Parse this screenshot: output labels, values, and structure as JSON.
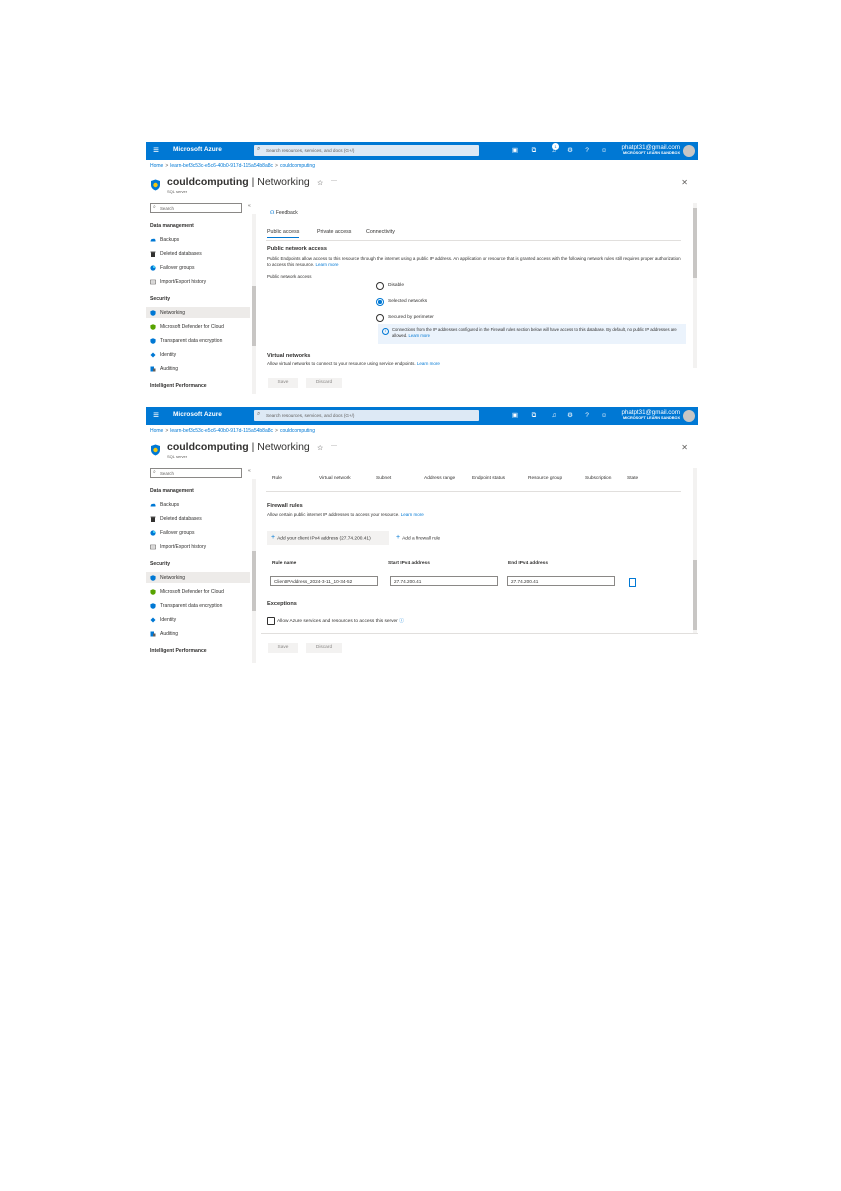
{
  "portal": {
    "brand": "Microsoft Azure",
    "search_placeholder": "Search resources, services, and docs (G+/)",
    "notification_count": "1",
    "account_email": "phatpt31@gmail.com",
    "account_directory": "MICROSOFT LEARN SANDBOX"
  },
  "breadcrumb": {
    "home": "Home",
    "resource_group": "learn-bef3c53c-e5c6-40b0-917d-115a54b8a8c",
    "server": "couldcomputing"
  },
  "page": {
    "title_bold": "couldcomputing",
    "title_rest": " | Networking",
    "subtitle": "SQL server"
  },
  "sidebar": {
    "search_placeholder": "Search",
    "collapse_glyph": "«",
    "groups": [
      {
        "label": "Data management",
        "items": [
          "Backups",
          "Deleted databases",
          "Failover groups",
          "Import/Export history"
        ]
      },
      {
        "label": "Security",
        "items": [
          "Networking",
          "Microsoft Defender for Cloud",
          "Transparent data encryption",
          "Identity",
          "Auditing"
        ]
      },
      {
        "label": "Intelligent Performance",
        "items": []
      }
    ],
    "selected": "Networking"
  },
  "colors": {
    "accent": "#0078d4",
    "selected_bg": "#edebe9",
    "info_bg": "#ebf3fc"
  },
  "screen1": {
    "feedback": "Feedback",
    "tabs": [
      "Public access",
      "Private access",
      "Connectivity"
    ],
    "active_tab": "Public access",
    "section_title": "Public network access",
    "description": "Public Endpoints allow access to this resource through the internet using a public IP address. An application or resource that is granted access with the following network rules still requires proper authorization to access this resource.",
    "learn_more": "Learn more",
    "field_label": "Public network access",
    "options": [
      "Disable",
      "Selected networks",
      "Secured by perimeter"
    ],
    "selected_option": "Selected networks",
    "info_text": "Connections from the IP addresses configured in the Firewall rules section below will have access to this database. By default, no public IP addresses are allowed.",
    "info_link": "Learn more",
    "vnet_title": "Virtual networks",
    "vnet_desc": "Allow virtual networks to connect to your resource using service endpoints.",
    "vnet_link": "Learn more",
    "save": "Save",
    "discard": "Discard"
  },
  "screen2": {
    "vnet_columns": [
      "Rule",
      "Virtual network",
      "Subnet",
      "Address range",
      "Endpoint status",
      "Resource group",
      "Subscription",
      "State"
    ],
    "firewall_title": "Firewall rules",
    "firewall_desc": "Allow certain public internet IP addresses to access your resource.",
    "firewall_link": "Learn more",
    "add_client_ip": "Add your client IPv4 address (27.74.200.41)",
    "add_rule": "Add a firewall rule",
    "columns": {
      "rule_name": "Rule name",
      "start_ip": "Start IPv4 address",
      "end_ip": "End IPv4 address"
    },
    "rule": {
      "name": "ClientIPAddress_2024-3-11_10-34-52",
      "start_ip": "27.74.200.41",
      "end_ip": "27.74.200.41"
    },
    "exceptions_title": "Exceptions",
    "exception_label": "Allow Azure services and resources to access this server",
    "exception_checked": false,
    "save": "Save",
    "discard": "Discard"
  }
}
